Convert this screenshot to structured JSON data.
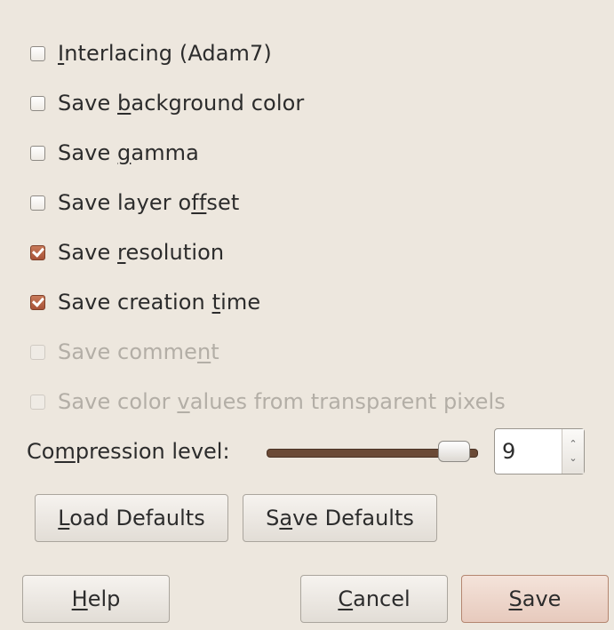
{
  "options": [
    {
      "pre": "",
      "u": "I",
      "post": "nterlacing (Adam7)",
      "checked": false,
      "disabled": false
    },
    {
      "pre": "Save ",
      "u": "b",
      "post": "ackground color",
      "checked": false,
      "disabled": false
    },
    {
      "pre": "Save ",
      "u": "g",
      "post": "amma",
      "checked": false,
      "disabled": false
    },
    {
      "pre": "Save layer o",
      "u": "ff",
      "post": "set",
      "checked": false,
      "disabled": false
    },
    {
      "pre": "Save ",
      "u": "r",
      "post": "esolution",
      "checked": true,
      "disabled": false
    },
    {
      "pre": "Save creation ",
      "u": "t",
      "post": "ime",
      "checked": true,
      "disabled": false
    },
    {
      "pre": "Save comme",
      "u": "n",
      "post": "t",
      "checked": false,
      "disabled": true
    },
    {
      "pre": "Save color ",
      "u": "v",
      "post": "alues from transparent pixels",
      "checked": false,
      "disabled": true
    }
  ],
  "compression": {
    "label_pre": "Co",
    "label_u": "m",
    "label_post": "pression level:",
    "value": "9",
    "slider_fraction": 1.0,
    "up_arrow": "⌃",
    "down_arrow": "⌄"
  },
  "defaults_buttons": {
    "load": {
      "pre": "",
      "u": "L",
      "post": "oad Defaults"
    },
    "save": {
      "pre": "S",
      "u": "a",
      "post": "ve Defaults"
    }
  },
  "action_buttons": {
    "help": {
      "pre": "",
      "u": "H",
      "post": "elp"
    },
    "cancel": {
      "pre": "",
      "u": "C",
      "post": "ancel"
    },
    "save": {
      "pre": "",
      "u": "S",
      "post": "ave"
    }
  },
  "colors": {
    "accent": "#b0573a",
    "background": "#ede7de"
  }
}
